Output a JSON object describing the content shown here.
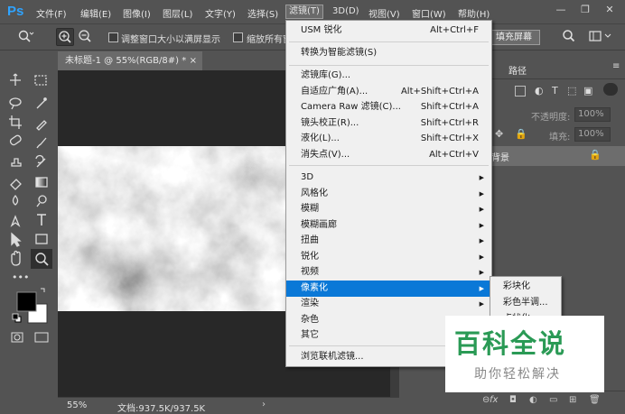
{
  "menubar": {
    "logo": "Ps",
    "items": [
      "文件(F)",
      "编辑(E)",
      "图像(I)",
      "图层(L)",
      "文字(Y)",
      "选择(S)",
      "滤镜(T)",
      "3D(D)",
      "视图(V)",
      "窗口(W)",
      "帮助(H)"
    ],
    "active_index": 6,
    "window_controls": [
      "—",
      "❐",
      "✕"
    ]
  },
  "options": {
    "zoom_tool_icon": "zoom-icon",
    "checkbox1_label": "调整窗口大小以满屏显示",
    "checkbox2_label": "缩放所有窗",
    "fill_screen_button": "填充屏幕"
  },
  "document": {
    "tab_title": "未标题-1 @ 55%(RGB/8#) *",
    "tab_close": "×",
    "zoom": "55%",
    "doc_info": "文档:937.5K/937.5K"
  },
  "panels": {
    "paths_tab": "路径",
    "opacity_label": "不透明度:",
    "opacity_value": "100%",
    "fill_label": "填充:",
    "fill_value": "100%",
    "background_layer": "背景"
  },
  "filter_menu": {
    "top": [
      {
        "label": "USM 锐化",
        "shortcut": "Alt+Ctrl+F"
      },
      {
        "label": "转换为智能滤镜(S)",
        "shortcut": ""
      }
    ],
    "middle": [
      {
        "label": "滤镜库(G)...",
        "shortcut": ""
      },
      {
        "label": "自适应广角(A)...",
        "shortcut": "Alt+Shift+Ctrl+A"
      },
      {
        "label": "Camera Raw 滤镜(C)...",
        "shortcut": "Shift+Ctrl+A"
      },
      {
        "label": "镜头校正(R)...",
        "shortcut": "Shift+Ctrl+R"
      },
      {
        "label": "液化(L)...",
        "shortcut": "Shift+Ctrl+X"
      },
      {
        "label": "消失点(V)...",
        "shortcut": "Alt+Ctrl+V"
      }
    ],
    "submenus": [
      "3D",
      "风格化",
      "模糊",
      "模糊画廊",
      "扭曲",
      "锐化",
      "视频",
      "像素化",
      "渲染",
      "杂色",
      "其它"
    ],
    "highlighted_submenu": "像素化",
    "bottom": "浏览联机滤镜..."
  },
  "pixelate_submenu": [
    "彩块化",
    "彩色半调...",
    "点状化..."
  ],
  "watermark": {
    "title": "百科全说",
    "subtitle": "助你轻松解决"
  },
  "colors": {
    "ui_dark": "#535353",
    "menu_bg": "#f0f0f0",
    "highlight": "#0a78d7",
    "logo_blue": "#2fa3ff",
    "watermark_green": "#2a9a55"
  }
}
